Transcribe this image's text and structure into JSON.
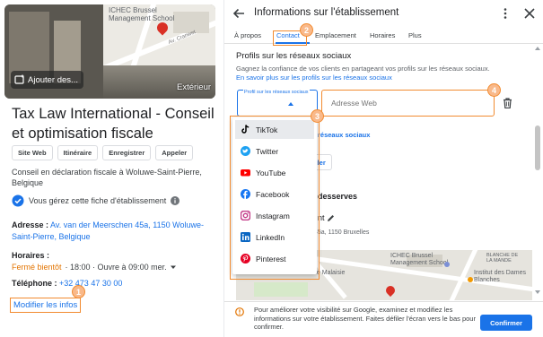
{
  "left": {
    "photos": {
      "map_label": "ICHEC Brussel Management School",
      "street_label": "Av. Cranwet",
      "add_photo_label": "Ajouter des...",
      "exterior_label": "Extérieur"
    },
    "title": "Tax Law International - Conseil et optimisation fiscale",
    "actions": [
      "Site Web",
      "Itinéraire",
      "Enregistrer",
      "Appeler"
    ],
    "description": "Conseil en déclaration fiscale à Woluwe-Saint-Pierre, Belgique",
    "managed_text": "Vous gérez cette fiche d'établissement",
    "address_label": "Adresse :",
    "address_value": "Av. van der Meerschen 45a, 1150 Woluwe-Saint-Pierre, Belgique",
    "hours_label": "Horaires :",
    "hours_status": "Fermé bientôt",
    "hours_detail": "· 18:00 · Ouvre à 09:00 mer.",
    "phone_label": "Téléphone :",
    "phone_value": "+32 473 47 30 00",
    "modify_link": "Modifier les infos"
  },
  "right": {
    "title": "Informations sur l'établissement",
    "tabs": [
      "À propos",
      "Contact",
      "Emplacement",
      "Horaires",
      "Plus"
    ],
    "active_tab": "Contact",
    "section_title": "Profils sur les réseaux sociaux",
    "section_desc": "Gagnez la confiance de vos clients en partageant vos profils sur les réseaux sociaux.",
    "section_link": "En savoir plus sur les profils sur les réseaux sociaux",
    "select_label": "Profil sur les réseaux sociaux",
    "web_placeholder": "Adresse Web",
    "add_profile_link": "réseaux sociaux",
    "cancel_partial": "uler",
    "areas_title": "desserves",
    "areas_sub": "nt",
    "areas_addr": "45a, 1150 Bruxelles",
    "map": {
      "poi_1": "ICHEC Brussel Management School",
      "poi_2": "Institut des Dames Blanches",
      "poi_3": "Jardin de Malaisie",
      "street_1": "BLANCHE DE LA MANDE"
    },
    "notice": "Pour améliorer votre visibilité sur Google, examinez et modifiez les informations sur votre établissement. Faites défiler l'écran vers le bas pour confirmer.",
    "confirm": "Confirmer"
  },
  "dropdown": {
    "items": [
      {
        "label": "TikTok",
        "icon": "tiktok-icon",
        "color": "#000000",
        "selected": true
      },
      {
        "label": "Twitter",
        "icon": "twitter-icon",
        "color": "#1da1f2",
        "selected": false
      },
      {
        "label": "YouTube",
        "icon": "youtube-icon",
        "color": "#ff0000",
        "selected": false
      },
      {
        "label": "Facebook",
        "icon": "facebook-icon",
        "color": "#1877f2",
        "selected": false
      },
      {
        "label": "Instagram",
        "icon": "instagram-icon",
        "color": "#c13584",
        "selected": false
      },
      {
        "label": "LinkedIn",
        "icon": "linkedin-icon",
        "color": "#0a66c2",
        "selected": false
      },
      {
        "label": "Pinterest",
        "icon": "pinterest-icon",
        "color": "#e60023",
        "selected": false
      }
    ]
  },
  "annotations": [
    "1",
    "2",
    "3",
    "4"
  ],
  "colors": {
    "accent": "#1a73e8",
    "annotation": "#f28b30",
    "warning": "#e37400"
  }
}
